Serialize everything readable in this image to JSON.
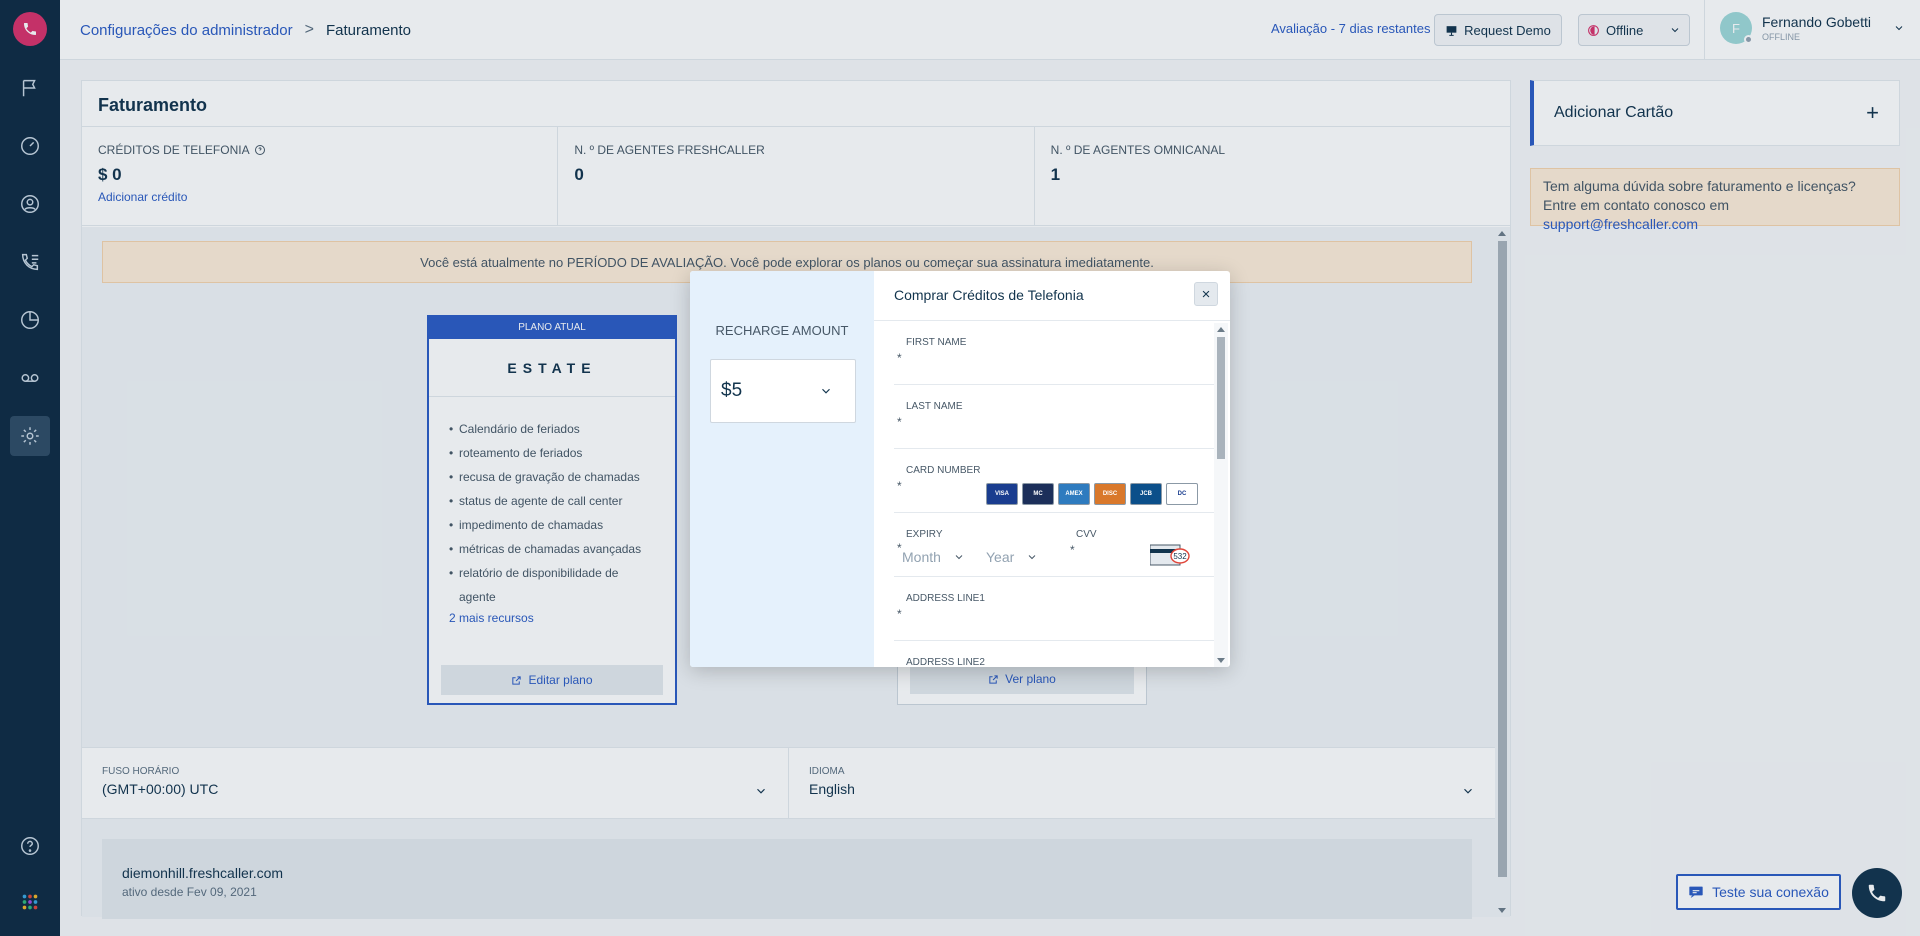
{
  "header": {
    "breadcrumb_root": "Configurações do administrador",
    "breadcrumb_separator": ">",
    "breadcrumb_current": "Faturamento",
    "trial_text": "Avaliação - 7 dias restantes",
    "request_demo": "Request Demo",
    "status": "Offline",
    "user_initial": "F",
    "user_name": "Fernando Gobetti",
    "user_status": "OFFLINE"
  },
  "billing": {
    "title": "Faturamento",
    "stats": [
      {
        "label": "CRÉDITOS DE TELEFONIA",
        "value": "$ 0",
        "link": "Adicionar crédito"
      },
      {
        "label": "N. º DE AGENTES FRESHCALLER",
        "value": "0"
      },
      {
        "label": "N. º DE AGENTES OMNICANAL",
        "value": "1"
      }
    ],
    "banner": "Você está atualmente no PERÍODO DE AVALIAÇÃO. Você pode explorar os planos ou começar sua assinatura imediatamente.",
    "plan": {
      "tag": "PLANO ATUAL",
      "name": "ESTATE",
      "features": [
        "Calendário de feriados",
        "roteamento de feriados",
        "recusa de gravação de chamadas",
        "status de agente de call center",
        "impedimento de chamadas",
        "métricas de chamadas avançadas",
        "relatório de disponibilidade de agente"
      ],
      "more": "2 mais recursos",
      "edit": "Editar plano"
    },
    "plan2_button": "Ver plano",
    "timezone_label": "FUSO HORÁRIO",
    "timezone_value": "(GMT+00:00) UTC",
    "language_label": "IDIOMA",
    "language_value": "English",
    "domain": "diemonhill.freshcaller.com",
    "active_since": "ativo desde Fev 09, 2021"
  },
  "right": {
    "add_card": "Adicionar Cartão",
    "plus": "+",
    "help_text": "Tem alguma dúvida sobre faturamento e licenças? Entre em contato conosco em",
    "help_email": "support@freshcaller.com"
  },
  "bottom": {
    "test_connection": "Teste sua conexão"
  },
  "modal": {
    "recharge_label": "RECHARGE AMOUNT",
    "amount": "$5",
    "title": "Comprar Créditos de Telefonia",
    "close": "×",
    "required_mark": "*",
    "fields": {
      "first_name": "FIRST NAME",
      "last_name": "LAST NAME",
      "card_number": "CARD NUMBER",
      "expiry": "EXPIRY",
      "cvv": "CVV",
      "address1": "ADDRESS LINE1",
      "address2": "ADDRESS LINE2"
    },
    "month_placeholder": "Month",
    "year_placeholder": "Year",
    "cvv_sample": "532",
    "card_brands": [
      "VISA",
      "MC",
      "AMEX",
      "DISC",
      "JCB",
      "DC"
    ],
    "card_colors": [
      "#1a3d8f",
      "#1c2f5a",
      "#2e7bbf",
      "#d9782b",
      "#0b4f8a",
      "#ffffff"
    ]
  }
}
